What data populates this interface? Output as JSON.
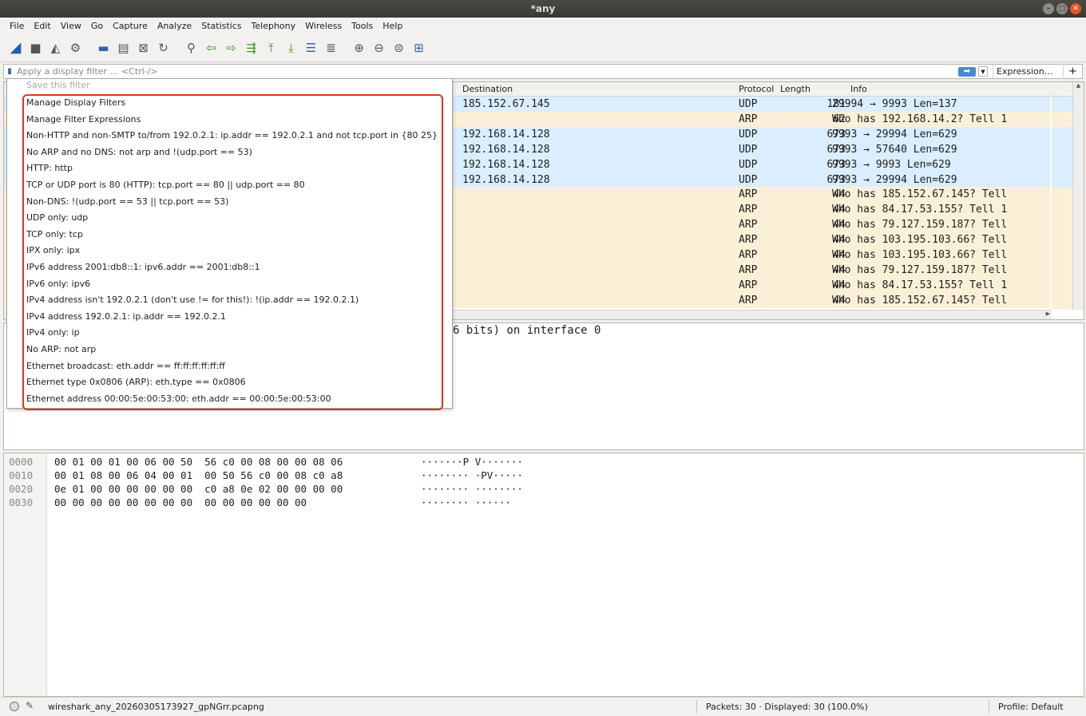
{
  "window": {
    "title": "*any"
  },
  "menu": [
    "File",
    "Edit",
    "View",
    "Go",
    "Capture",
    "Analyze",
    "Statistics",
    "Telephony",
    "Wireless",
    "Tools",
    "Help"
  ],
  "filter": {
    "placeholder": "Apply a display filter … <Ctrl-/>",
    "expression_label": "Expression…",
    "plus_label": "+"
  },
  "packet_list": {
    "columns": {
      "destination": "Destination",
      "protocol": "Protocol",
      "length": "Length",
      "info": "Info"
    },
    "rows": [
      {
        "destination": "185.152.67.145",
        "protocol": "UDP",
        "length": "181",
        "info": "29994 → 9993 Len=137",
        "kind": "udp"
      },
      {
        "destination": "",
        "protocol": "ARP",
        "length": "62",
        "info": "Who has 192.168.14.2? Tell 1",
        "kind": "arp"
      },
      {
        "destination": "192.168.14.128",
        "protocol": "UDP",
        "length": "673",
        "info": "9993 → 29994 Len=629",
        "kind": "udp"
      },
      {
        "destination": "192.168.14.128",
        "protocol": "UDP",
        "length": "673",
        "info": "9993 → 57640 Len=629",
        "kind": "udp"
      },
      {
        "destination": "192.168.14.128",
        "protocol": "UDP",
        "length": "673",
        "info": "9993 → 9993 Len=629",
        "kind": "udp"
      },
      {
        "destination": "192.168.14.128",
        "protocol": "UDP",
        "length": "673",
        "info": "9993 → 29994 Len=629",
        "kind": "udp"
      },
      {
        "destination": "",
        "protocol": "ARP",
        "length": "44",
        "info": "Who has 185.152.67.145? Tell",
        "kind": "arp"
      },
      {
        "destination": "",
        "protocol": "ARP",
        "length": "44",
        "info": "Who has 84.17.53.155? Tell 1",
        "kind": "arp"
      },
      {
        "destination": "",
        "protocol": "ARP",
        "length": "44",
        "info": "Who has 79.127.159.187? Tell",
        "kind": "arp"
      },
      {
        "destination": "",
        "protocol": "ARP",
        "length": "44",
        "info": "Who has 103.195.103.66? Tell",
        "kind": "arp"
      },
      {
        "destination": "",
        "protocol": "ARP",
        "length": "44",
        "info": "Who has 103.195.103.66? Tell",
        "kind": "arp"
      },
      {
        "destination": "",
        "protocol": "ARP",
        "length": "44",
        "info": "Who has 79.127.159.187? Tell",
        "kind": "arp"
      },
      {
        "destination": "",
        "protocol": "ARP",
        "length": "44",
        "info": "Who has 84.17.53.155? Tell 1",
        "kind": "arp"
      },
      {
        "destination": "",
        "protocol": "ARP",
        "length": "44",
        "info": "Who has 185.152.67.145? Tell",
        "kind": "arp"
      }
    ]
  },
  "details": {
    "line": "6 bits) on interface 0"
  },
  "bytes": [
    {
      "offset": "0000",
      "hex": "00 01 00 01 00 06 00 50  56 c0 00 08 00 00 08 06",
      "ascii": "·······P V·······"
    },
    {
      "offset": "0010",
      "hex": "00 01 08 00 06 04 00 01  00 50 56 c0 00 08 c0 a8",
      "ascii": "········ ·PV·····"
    },
    {
      "offset": "0020",
      "hex": "0e 01 00 00 00 00 00 00  c0 a8 0e 02 00 00 00 00",
      "ascii": "········ ········"
    },
    {
      "offset": "0030",
      "hex": "00 00 00 00 00 00 00 00  00 00 00 00 00 00",
      "ascii": "········ ······"
    }
  ],
  "filter_menu": {
    "save": "Save this filter",
    "items": [
      "Manage Display Filters",
      "Manage Filter Expressions",
      "Non-HTTP and non-SMTP to/from 192.0.2.1: ip.addr == 192.0.2.1 and not tcp.port in {80 25}",
      "No ARP and no DNS: not arp and !(udp.port == 53)",
      "HTTP: http",
      "TCP or UDP port is 80 (HTTP): tcp.port == 80 || udp.port == 80",
      "Non-DNS: !(udp.port == 53 || tcp.port == 53)",
      "UDP only: udp",
      "TCP only: tcp",
      "IPX only: ipx",
      "IPv6 address 2001:db8::1: ipv6.addr == 2001:db8::1",
      "IPv6 only: ipv6",
      "IPv4 address isn't 192.0.2.1 (don't use != for this!): !(ip.addr == 192.0.2.1)",
      "IPv4 address 192.0.2.1: ip.addr == 192.0.2.1",
      "IPv4 only: ip",
      "No ARP: not arp",
      "Ethernet broadcast: eth.addr == ff:ff:ff:ff:ff:ff",
      "Ethernet type 0x0806 (ARP): eth.type == 0x0806",
      "Ethernet address 00:00:5e:00:53:00: eth.addr == 00:00:5e:00:53:00"
    ]
  },
  "status": {
    "file": "wireshark_any_20260305173927_gpNGrr.pcapng",
    "packets": "Packets: 30 · Displayed: 30 (100.0%)",
    "profile": "Profile: Default"
  },
  "colors": {
    "udp_row": "#daeeff",
    "arp_row": "#faf0d7",
    "highlight": "#e0321e"
  }
}
